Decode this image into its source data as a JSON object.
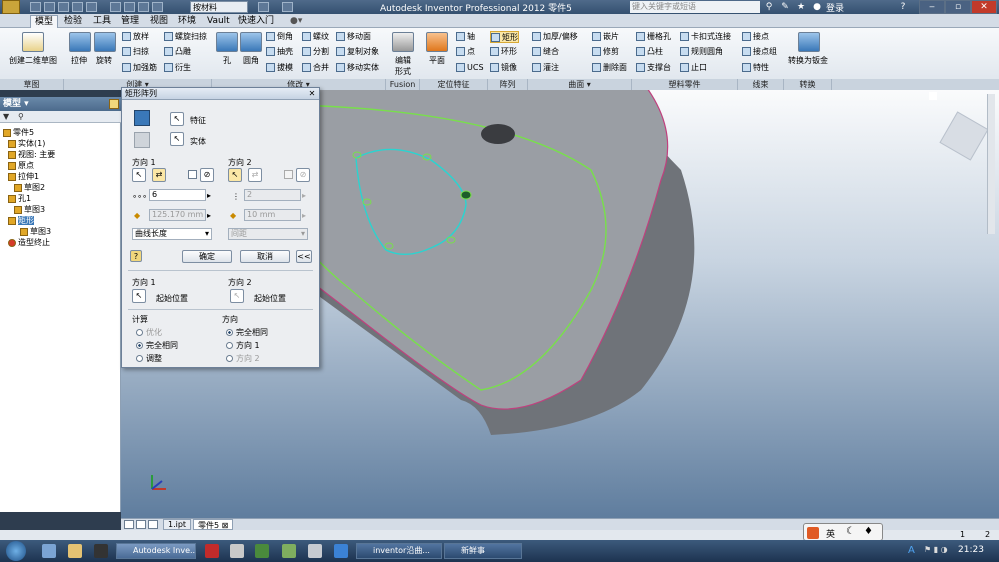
{
  "titlebar": {
    "material": "按材料",
    "title": "Autodesk Inventor Professional 2012   零件5",
    "search_placeholder": "键入关键字或短语",
    "login": "登录"
  },
  "menu": {
    "tabs": [
      "模型",
      "检验",
      "工具",
      "管理",
      "视图",
      "环境",
      "Vault",
      "快速入门"
    ]
  },
  "ribbon": {
    "sketch": {
      "create_sketch": "创建二维草图",
      "group": "草图"
    },
    "create": {
      "extrude": "拉伸",
      "revolve": "旋转",
      "loft": "放样",
      "sweep": "扫掠",
      "rib": "加强筋",
      "coil": "螺旋扫掠",
      "emboss": "凸雕",
      "derive": "衍生",
      "group": "创建 ▾"
    },
    "modify": {
      "hole": "孔",
      "fillet": "圆角",
      "chamfer": "倒角",
      "shell": "抽壳",
      "draft": "拔模",
      "thread": "螺纹",
      "split": "分割",
      "combine": "合并",
      "move_face": "移动面",
      "copy_object": "复制对象",
      "move_body": "移动实体",
      "group": "修改 ▾"
    },
    "fusion": {
      "edit_form": "编辑\n形式",
      "group": "Fusion"
    },
    "work": {
      "plane": "平面",
      "axis": "轴",
      "point": "点",
      "ucs": "UCS",
      "group": "定位特征"
    },
    "pattern": {
      "rect": "矩形",
      "circ": "环形",
      "mirror": "镜像",
      "group": "阵列"
    },
    "surface": {
      "thicken": "加厚/偏移",
      "stitch": "缝合",
      "patch": "灌注",
      "sculpt": "嵌片",
      "trim": "修剪",
      "delete_face": "删除面",
      "group": "曲面 ▾"
    },
    "plastic": {
      "grill": "栅格孔",
      "boss": "凸柱",
      "rest": "支撑台",
      "snap": "卡扣式连接",
      "rule_fillet": "规则圆角",
      "lip": "止口",
      "group": "塑料零件"
    },
    "harness": {
      "splice": "接点",
      "splice_grp": "接点组",
      "property": "特性",
      "group": "线束"
    },
    "convert": {
      "to_sheet": "转换为钣金",
      "group": "转换"
    }
  },
  "browser": {
    "title": "模型 ▾",
    "tree": [
      "零件5",
      "实体(1)",
      "视图: 主要",
      "原点",
      "拉伸1",
      "草图2",
      "孔1",
      "草图3",
      "矩形",
      "草图3",
      "造型终止"
    ]
  },
  "dialog": {
    "title": "矩形阵列",
    "features_label": "特征",
    "solids_label": "实体",
    "dir1": "方向 1",
    "dir2": "方向 2",
    "count1": "6",
    "count2": "2",
    "spacing1": "125.170 mm",
    "spacing2": "10 mm",
    "type1": "曲线长度",
    "type2": "间距",
    "ok": "确定",
    "cancel": "取消",
    "more": "<<",
    "start1_head": "方向 1",
    "start1": "起始位置",
    "start2_head": "方向 2",
    "start2": "起始位置",
    "compute": "计算",
    "optimize": "优化",
    "identical": "完全相同",
    "adjust": "调整",
    "orient": "方向",
    "orient_identical": "完全相同",
    "orient_dir1": "方向 1",
    "orient_dir2": "方向 2"
  },
  "doctabs": {
    "tab1": "1.ipt",
    "tab2": "零件5"
  },
  "status": {
    "page1": "1",
    "page2": "2"
  },
  "taskbar": {
    "items": [
      "Autodesk Inve...",
      "inventor沿曲...",
      "新鲜事"
    ],
    "ime": "英",
    "clock": "21:23"
  },
  "colors": {
    "accent": "#3a78b8",
    "outline": "#78e04a",
    "sketch": "#2ad4d0",
    "body": "#8e9298"
  }
}
